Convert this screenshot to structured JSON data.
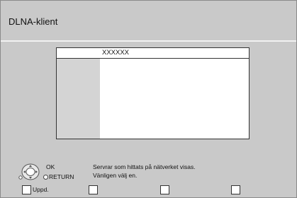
{
  "window": {
    "title": "DLNA-klient"
  },
  "list": {
    "header": "XXXXXX"
  },
  "nav": {
    "ok_label": "OK",
    "return_label": "RETURN"
  },
  "message": {
    "line1": "Servrar som hittats på nätverket visas.",
    "line2": "Vänligen välj en."
  },
  "buttons": [
    {
      "label": "Uppd."
    },
    {
      "label": ""
    },
    {
      "label": ""
    },
    {
      "label": ""
    }
  ]
}
